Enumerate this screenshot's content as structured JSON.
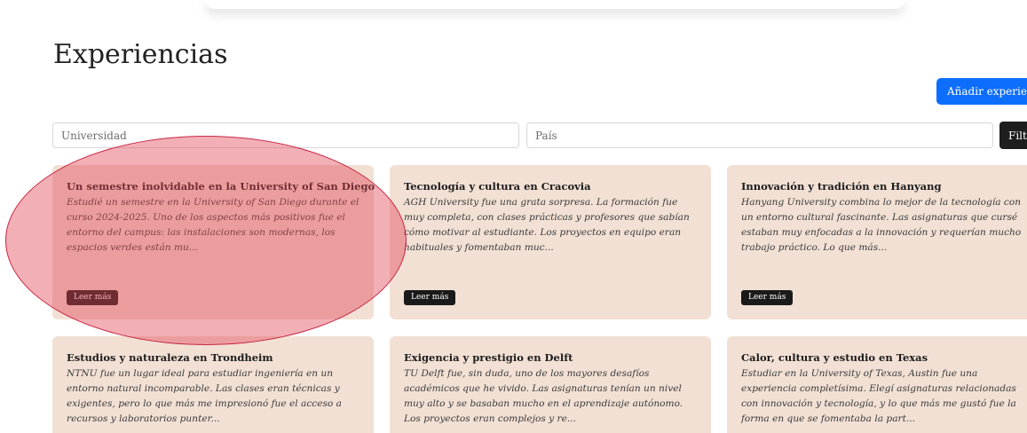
{
  "page": {
    "title": "Experiencias",
    "add_button_label": "Añadir experien"
  },
  "filters": {
    "university_placeholder": "Universidad",
    "country_placeholder": "País",
    "filter_button_label": "Filt"
  },
  "cards": [
    {
      "title": "Un semestre inolvidable en la University of San Diego",
      "excerpt": "Estudié un semestre en la University of San Diego durante el curso 2024-2025. Uno de los aspectos más positivos fue el entorno del campus: las instalaciones son modernas, los espacios verdes están mu...",
      "button_label": "Leer más"
    },
    {
      "title": "Tecnología y cultura en Cracovia",
      "excerpt": "AGH University fue una grata sorpresa. La formación fue muy completa, con clases prácticas y profesores que sabían cómo motivar al estudiante. Los proyectos en equipo eran habituales y fomentaban muc...",
      "button_label": "Leer más"
    },
    {
      "title": "Innovación y tradición en Hanyang",
      "excerpt": "Hanyang University combina lo mejor de la tecnología con un entorno cultural fascinante. Las asignaturas que cursé estaban muy enfocadas a la innovación y requerían mucho trabajo práctico. Lo que más...",
      "button_label": "Leer más"
    },
    {
      "title": "Estudios y naturaleza en Trondheim",
      "excerpt": "NTNU fue un lugar ideal para estudiar ingeniería en un entorno natural incomparable. Las clases eran técnicas y exigentes, pero lo que más me impresionó fue el acceso a recursos y laboratorios punter..."
    },
    {
      "title": "Exigencia y prestigio en Delft",
      "excerpt": "TU Delft fue, sin duda, uno de los mayores desafíos académicos que he vivido. Las asignaturas tenían un nivel muy alto y se basaban mucho en el aprendizaje autónomo. Los proyectos eran complejos y re..."
    },
    {
      "title": "Calor, cultura y estudio en Texas",
      "excerpt": "Estudiar en la University of Texas, Austin fue una experiencia completísima. Elegí asignaturas relacionadas con innovación y tecnología, y lo que más me gustó fue la forma en que se fomentaba la part..."
    }
  ],
  "colors": {
    "accent_blue": "#0d6efd",
    "card_background": "#f2e0d4",
    "highlight_fill": "#e24656",
    "highlight_stroke": "#c4183a"
  }
}
